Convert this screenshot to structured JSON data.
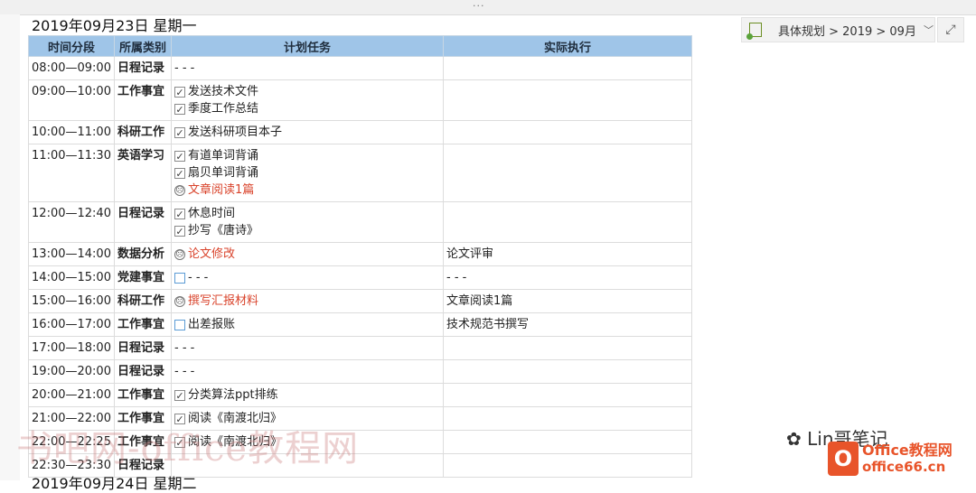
{
  "page": {
    "title": "2019年09月23日 星期一",
    "next_title": "2019年09月24日 星期二"
  },
  "breadcrumb": {
    "label": "具体规划 > 2019 > 09月"
  },
  "table": {
    "headers": [
      "时间分段",
      "所属类别",
      "计划任务",
      "实际执行"
    ],
    "rows": [
      {
        "time": "08:00—09:00",
        "cat": "日程记录",
        "tasks": [
          {
            "icon": "none",
            "text": "- - -"
          }
        ],
        "actual": ""
      },
      {
        "time": "09:00—10:00",
        "cat": "工作事宜",
        "tasks": [
          {
            "icon": "check",
            "text": "发送技术文件"
          },
          {
            "icon": "check",
            "text": "季度工作总结"
          }
        ],
        "actual": ""
      },
      {
        "time": "10:00—11:00",
        "cat": "科研工作",
        "tasks": [
          {
            "icon": "check",
            "text": "发送科研项目本子"
          }
        ],
        "actual": ""
      },
      {
        "time": "11:00—11:30",
        "cat": "英语学习",
        "tasks": [
          {
            "icon": "check",
            "text": "有道单词背诵"
          },
          {
            "icon": "check",
            "text": "扇贝单词背诵"
          },
          {
            "icon": "face",
            "text": "文章阅读1篇",
            "red": true
          }
        ],
        "actual": ""
      },
      {
        "time": "12:00—12:40",
        "cat": "日程记录",
        "tasks": [
          {
            "icon": "check",
            "text": "休息时间"
          },
          {
            "icon": "check",
            "text": "抄写《唐诗》"
          }
        ],
        "actual": ""
      },
      {
        "time": "13:00—14:00",
        "cat": "数据分析",
        "tasks": [
          {
            "icon": "face",
            "text": "论文修改",
            "red": true
          }
        ],
        "actual": "论文评审"
      },
      {
        "time": "14:00—15:00",
        "cat": "党建事宜",
        "tasks": [
          {
            "icon": "empty",
            "text": "- - -"
          }
        ],
        "actual": "- - -"
      },
      {
        "time": "15:00—16:00",
        "cat": "科研工作",
        "tasks": [
          {
            "icon": "face",
            "text": "撰写汇报材料",
            "red": true
          }
        ],
        "actual": "文章阅读1篇"
      },
      {
        "time": "16:00—17:00",
        "cat": "工作事宜",
        "tasks": [
          {
            "icon": "empty",
            "text": "出差报账"
          }
        ],
        "actual": "技术规范书撰写"
      },
      {
        "time": "17:00—18:00",
        "cat": "日程记录",
        "tasks": [
          {
            "icon": "none",
            "text": "- - -"
          }
        ],
        "actual": ""
      },
      {
        "time": "19:00—20:00",
        "cat": "日程记录",
        "tasks": [
          {
            "icon": "none",
            "text": "- - -"
          }
        ],
        "actual": ""
      },
      {
        "time": "20:00—21:00",
        "cat": "工作事宜",
        "tasks": [
          {
            "icon": "check",
            "text": "分类算法ppt排练"
          }
        ],
        "actual": ""
      },
      {
        "time": "21:00—22:00",
        "cat": "工作事宜",
        "tasks": [
          {
            "icon": "check",
            "text": "阅读《南渡北归》"
          }
        ],
        "actual": ""
      },
      {
        "time": "22:00—22:25",
        "cat": "工作事宜",
        "tasks": [
          {
            "icon": "check",
            "text": "阅读《南渡北归》"
          }
        ],
        "actual": ""
      },
      {
        "time": "22:30—23:30",
        "cat": "日程记录",
        "tasks": [
          {
            "icon": "none",
            "text": ""
          }
        ],
        "actual": ""
      }
    ]
  },
  "overlay": {
    "watermark": "书吧网-office教程网",
    "wechat": "✿ Lin哥笔记",
    "logo_line1": "Office教程网",
    "logo_line2": "office66.cn"
  }
}
